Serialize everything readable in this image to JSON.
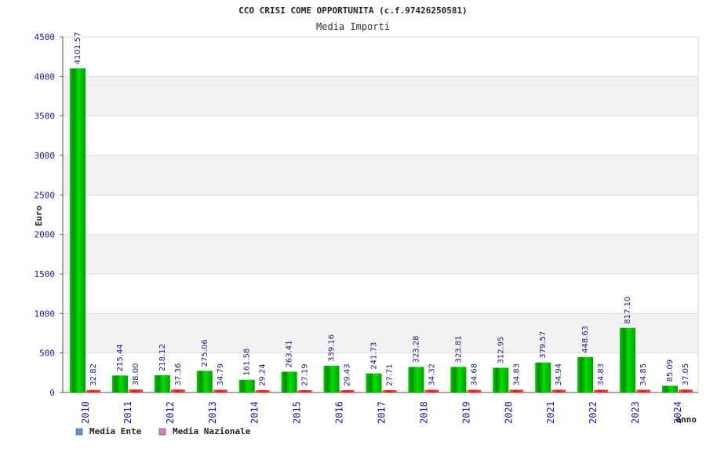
{
  "chart_data": {
    "type": "bar",
    "title": "CCO CRISI COME OPPORTUNITA (c.f.97426250581)",
    "subtitle": "Media Importi",
    "xlabel": "anno",
    "ylabel": "Euro",
    "ylim": [
      0,
      4500
    ],
    "yticks": [
      0,
      500,
      1000,
      1500,
      2000,
      2500,
      3000,
      3500,
      4000,
      4500
    ],
    "grid": true,
    "legend_position": "bottom-left",
    "categories": [
      "2010",
      "2011",
      "2012",
      "2013",
      "2014",
      "2015",
      "2016",
      "2017",
      "2018",
      "2019",
      "2020",
      "2021",
      "2022",
      "2023",
      "2024"
    ],
    "series": [
      {
        "name": "Media Ente",
        "color": "#00b400",
        "legend_color": "#5b9bd5",
        "values": [
          4101.57,
          215.44,
          218.12,
          275.06,
          161.58,
          263.41,
          339.16,
          241.73,
          323.28,
          323.81,
          312.95,
          379.57,
          448.63,
          817.1,
          85.09
        ],
        "labels": [
          "4101.57",
          "215.44",
          "218.12",
          "275.06",
          "161.58",
          "263.41",
          "339.16",
          "241.73",
          "323.28",
          "323.81",
          "312.95",
          "379.57",
          "448.63",
          "817.10",
          "85.09"
        ]
      },
      {
        "name": "Media Nazionale",
        "color": "#e83a3a",
        "legend_color": "#e377c2",
        "values": [
          32.82,
          38.0,
          37.36,
          34.79,
          29.24,
          27.19,
          29.43,
          27.71,
          34.32,
          34.68,
          34.83,
          34.94,
          34.83,
          34.85,
          37.05
        ],
        "labels": [
          "32.82",
          "38.00",
          "37.36",
          "34.79",
          "29.24",
          "27.19",
          "29.43",
          "27.71",
          "34.32",
          "34.68",
          "34.83",
          "34.94",
          "34.83",
          "34.85",
          "37.05"
        ]
      }
    ]
  }
}
